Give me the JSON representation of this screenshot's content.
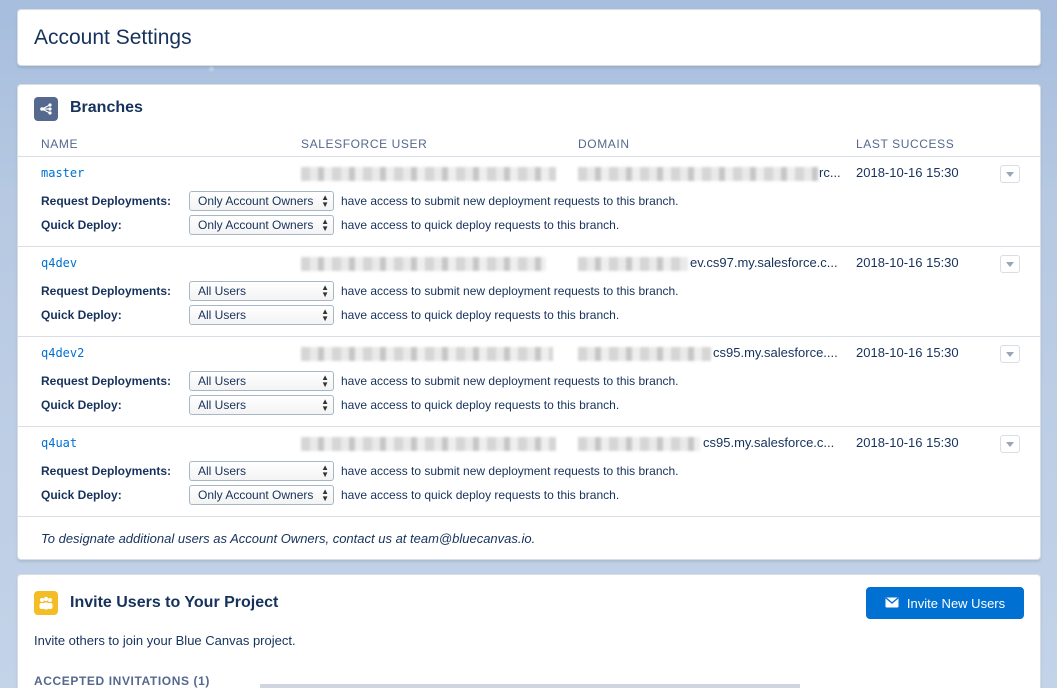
{
  "page": {
    "title": "Account Settings"
  },
  "branches_card": {
    "title": "Branches",
    "icon": "branch-icon",
    "columns": {
      "name": "NAME",
      "user": "SALESFORCE USER",
      "domain": "DOMAIN",
      "last_success": "LAST SUCCESS"
    },
    "field_labels": {
      "request": "Request Deployments:",
      "quick": "Quick Deploy:"
    },
    "field_descs": {
      "request": "have access to submit new deployment requests to this branch.",
      "quick": "have access to quick deploy requests to this branch."
    },
    "branches": [
      {
        "name": "master",
        "domain_tail": "rc...",
        "last_success": "2018-10-16 15:30",
        "request": "Only Account Owners",
        "quick": "Only Account Owners"
      },
      {
        "name": "q4dev",
        "domain_tail": "ev.cs97.my.salesforce.c...",
        "last_success": "2018-10-16 15:30",
        "request": "All Users",
        "quick": "All Users"
      },
      {
        "name": "q4dev2",
        "domain_tail": "cs95.my.salesforce....",
        "last_success": "2018-10-16 15:30",
        "request": "All Users",
        "quick": "All Users"
      },
      {
        "name": "q4uat",
        "domain_tail": "cs95.my.salesforce.c...",
        "last_success": "2018-10-16 15:30",
        "request": "All Users",
        "quick": "Only Account Owners"
      }
    ],
    "footnote": "To designate additional users as Account Owners, contact us at team@bluecanvas.io."
  },
  "invite_card": {
    "title": "Invite Users to Your Project",
    "icon": "people-icon",
    "button_label": "Invite New Users",
    "button_icon": "mail-icon",
    "description": "Invite others to join your Blue Canvas project.",
    "accepted_label": "ACCEPTED INVITATIONS (1)"
  },
  "colors": {
    "brand": "#0070d2",
    "text": "#16325c",
    "invite_icon": "#f4bc25",
    "branch_icon": "#54698d"
  }
}
